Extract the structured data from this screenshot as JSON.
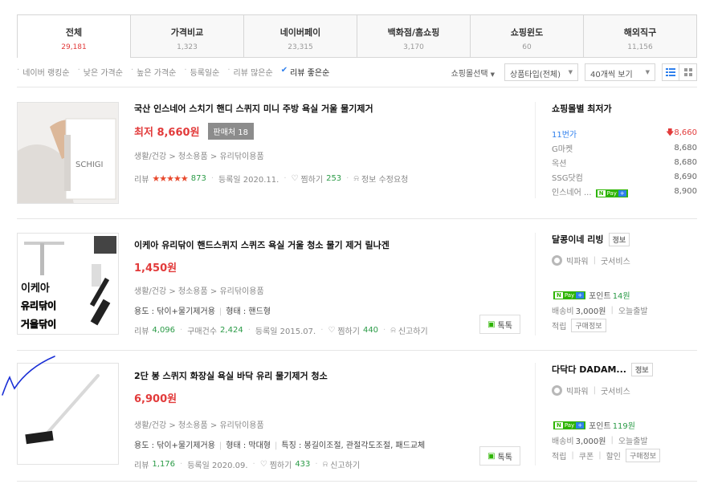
{
  "tabs": [
    {
      "label": "전체",
      "count": "29,181",
      "active": true
    },
    {
      "label": "가격비교",
      "count": "1,323"
    },
    {
      "label": "네이버페이",
      "count": "23,315"
    },
    {
      "label": "백화점/홈쇼핑",
      "count": "3,170"
    },
    {
      "label": "쇼핑윈도",
      "count": "60"
    },
    {
      "label": "해외직구",
      "count": "11,156"
    }
  ],
  "sort": {
    "items": [
      "네이버 랭킹순",
      "낮은 가격순",
      "높은 가격순",
      "등록일순",
      "리뷰 많은순",
      "리뷰 좋은순"
    ],
    "mall_select": "쇼핑몰선택",
    "product_type": "상품타입(전체)",
    "page_size": "40개씩 보기"
  },
  "products": [
    {
      "title": "국산 인스네어 스치기 핸디 스퀴지 미니 주방 욕실 거울 물기제거",
      "price": "최저 8,660원",
      "sellers": "판매처 18",
      "category": "생활/건강 > 청소용품 > 유리닦이용품",
      "review_label": "리뷰",
      "review_count": "873",
      "reg_date": "등록일 2020.11.",
      "wish": "찜하기",
      "wish_count": "253",
      "report": "정보 수정요청",
      "thumb_text": "SCHIGI",
      "lowest_title": "쇼핑몰별 최저가",
      "malls": [
        {
          "name": "11번가",
          "price": "8,660",
          "low": true
        },
        {
          "name": "G마켓",
          "price": "8,680"
        },
        {
          "name": "옥션",
          "price": "8,680"
        },
        {
          "name": "SSG닷컴",
          "price": "8,690"
        },
        {
          "name": "인스네어 ...",
          "price": "8,900",
          "npay": true
        }
      ]
    },
    {
      "title": "이케아 유리닦이 핸드스퀴지 스퀴즈 욕실 거울 청소 물기 제거 릴나겐",
      "price": "1,450원",
      "category": "생활/건강 > 청소용품 > 유리닦이용품",
      "spec": "용도 : 닦이+물기제거용",
      "spec2": "형태 : 핸드형",
      "review_label": "리뷰",
      "review_count": "4,096",
      "buy_label": "구매건수",
      "buy_count": "2,424",
      "reg_date": "등록일 2015.07.",
      "wish": "찜하기",
      "wish_count": "440",
      "report": "신고하기",
      "talk": "톡톡",
      "thumb_lines": [
        "이케아",
        "유리닦이",
        "거울닦이"
      ],
      "shop": "달콩이네 리빙",
      "shop_tag": "정보",
      "grade": "빅파워",
      "service": "굿서비스",
      "point_label": "포인트",
      "point": "14원",
      "ship_label": "배송비",
      "ship": "3,000원",
      "ship_today": "오늘출발",
      "extra1": "적립",
      "buy_info": "구매정보"
    },
    {
      "title": "2단 봉 스퀴지 화장실 욕실 바닥 유리 물기제거 청소",
      "price": "6,900원",
      "category": "생활/건강 > 청소용품 > 유리닦이용품",
      "spec": "용도 : 닦이+물기제거용",
      "spec2": "형태 : 막대형",
      "spec3": "특징 : 봉길이조절, 관절각도조절, 패드교체",
      "review_label": "리뷰",
      "review_count": "1,176",
      "reg_date": "등록일 2020.09.",
      "wish": "찜하기",
      "wish_count": "433",
      "report": "신고하기",
      "talk": "톡톡",
      "shop": "다닥다 DADAM...",
      "shop_tag": "정보",
      "grade": "빅파워",
      "service": "굿서비스",
      "point_label": "포인트",
      "point": "119원",
      "ship_label": "배송비",
      "ship": "3,000원",
      "ship_today": "오늘출발",
      "extra1": "적립",
      "extra2": "쿠폰",
      "extra3": "할인",
      "buy_info": "구매정보"
    }
  ],
  "npay": {
    "n": "N",
    "pay": "Pay",
    "plus": "+"
  },
  "colors": {
    "price_red": "#e23b3b",
    "link_green": "#2b9b47",
    "npay_green": "#2db400",
    "check_blue": "#1a2fd6"
  }
}
